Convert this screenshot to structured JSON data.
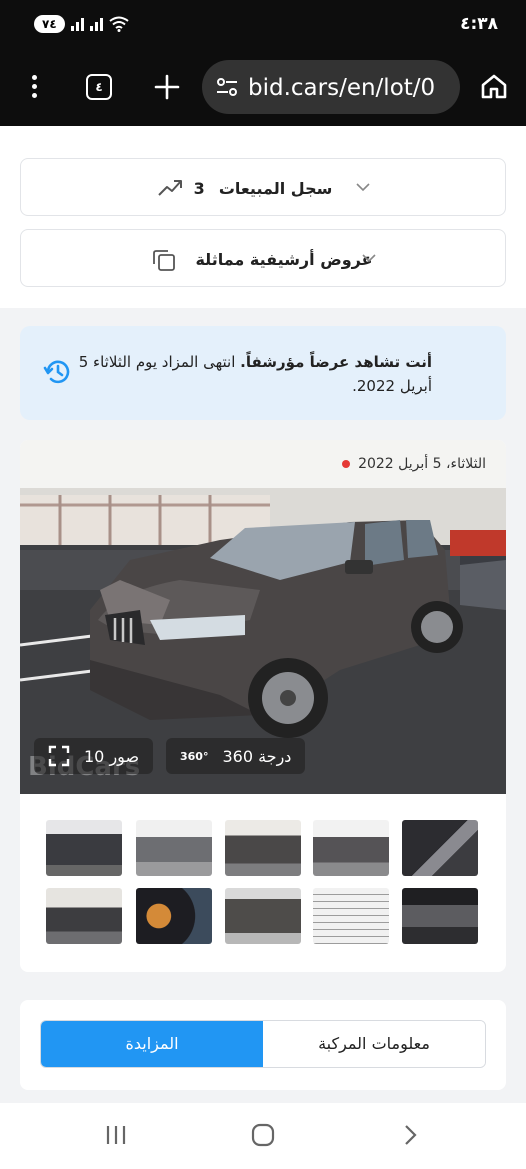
{
  "status_bar": {
    "time": "٤:٣٨",
    "battery": "٧٤"
  },
  "browser": {
    "url": "bid.cars/en/lot/0",
    "tab_count": "٤"
  },
  "sales_history": {
    "count": "3",
    "label": "سجل المبيعات"
  },
  "similar_offers": {
    "label": "عروض أرشيفية مماثلة"
  },
  "alert": {
    "line_bold": "أنت تشاهد عرضاً مؤرشفاً.",
    "line_text": " انتهى المزاد يوم الثلاثاء 5 أبريل 2022."
  },
  "gallery": {
    "date": "الثلاثاء، 5 أبريل 2022",
    "photos_count": "10 صور",
    "view360": "360 درجة",
    "icon_360_text": "360°",
    "watermark": "BidCars"
  },
  "tabs": {
    "auction": "المزايدة",
    "vehicle_info": "معلومات المركبة"
  },
  "colors": {
    "accent": "#2196f3",
    "alert_bg": "#e4f0fb",
    "live_dot": "#e53935"
  }
}
